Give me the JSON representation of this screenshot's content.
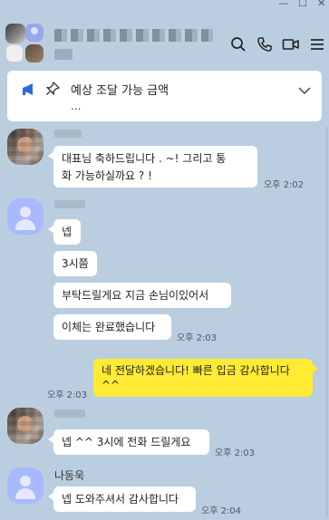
{
  "window": {
    "minimize": "—",
    "maximize": "☐",
    "close": "✕"
  },
  "header": {
    "icons": [
      "search-icon",
      "phone-icon",
      "video-icon",
      "menu-icon"
    ]
  },
  "notice": {
    "title": "예상 조달 가능 금액",
    "body": "..."
  },
  "messages": [
    {
      "text_line1": "대표님 축하드립니다 .  ~!  그리고 통",
      "text_line2": "화 가능하실까요 ? !",
      "time": "오후 2:02"
    },
    {
      "text": "넵"
    },
    {
      "text": "3시쯤"
    },
    {
      "text": "부탁드릴게요 지금 손님이있어서"
    },
    {
      "text": "이체는 완료했습니다",
      "time": "오후 2:03"
    },
    {
      "text_line1": "네 전달하겠습니다! 빠른 입금 감사합니다",
      "text_line2": "^^",
      "time": "오후 2:03"
    },
    {
      "text": "넵 ^^ 3시에 전화 드릴게요",
      "time": "오후 2:03"
    },
    {
      "sender": "나동욱",
      "text": "넵 도와주셔서 감사합니다",
      "time": "오후 2:04"
    }
  ],
  "colors": {
    "background": "#bacee0",
    "my_bubble": "#ffeb33",
    "other_bubble": "#ffffff",
    "notice_icon": "#2b6bd9"
  }
}
